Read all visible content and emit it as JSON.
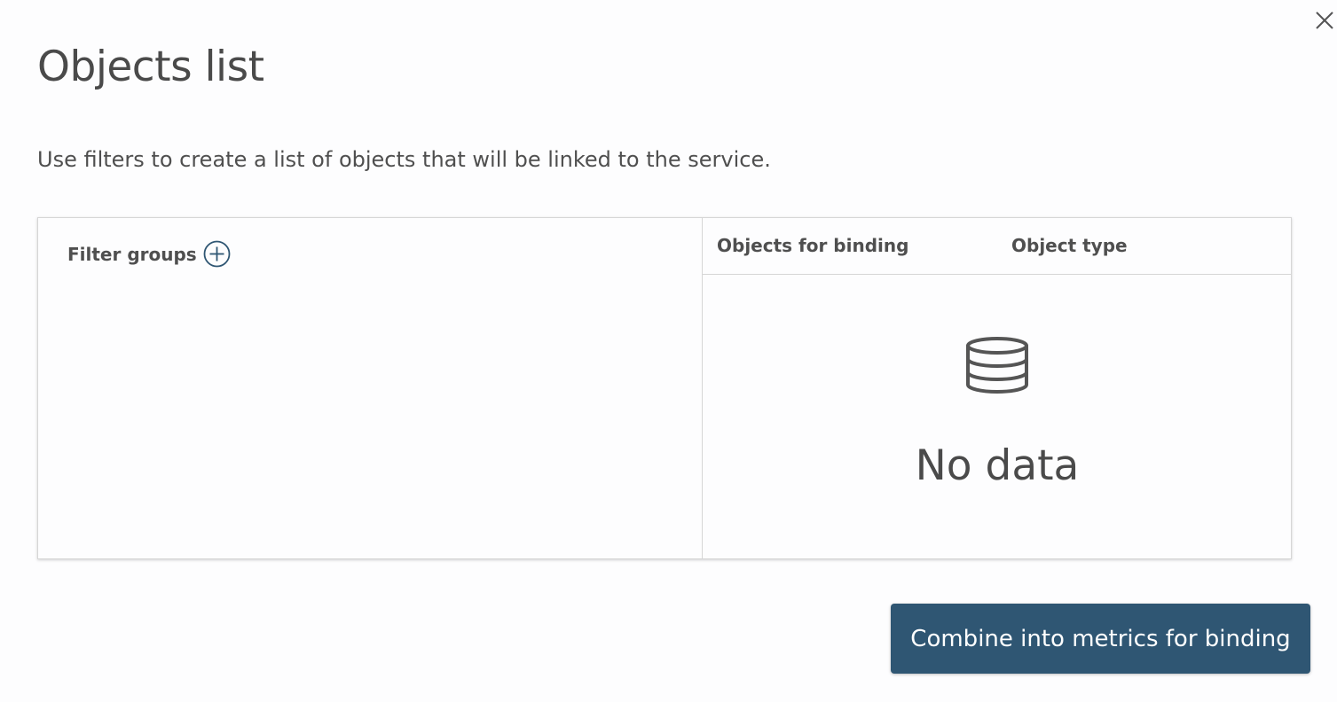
{
  "dialog": {
    "title": "Objects list",
    "subtitle": "Use filters to create a list of objects that will be linked to the service.",
    "close_icon": "close-icon"
  },
  "filters": {
    "label": "Filter groups",
    "add_icon": "plus-circle-icon"
  },
  "table": {
    "columns": [
      "Objects for binding",
      "Object type"
    ],
    "empty_icon": "database-icon",
    "empty_text": "No data"
  },
  "footer": {
    "primary_button": "Combine into metrics for binding"
  },
  "colors": {
    "accent": "#2f5673",
    "text": "#4a4a4a",
    "border": "#d6d6d6",
    "background": "#fdfdfe"
  }
}
